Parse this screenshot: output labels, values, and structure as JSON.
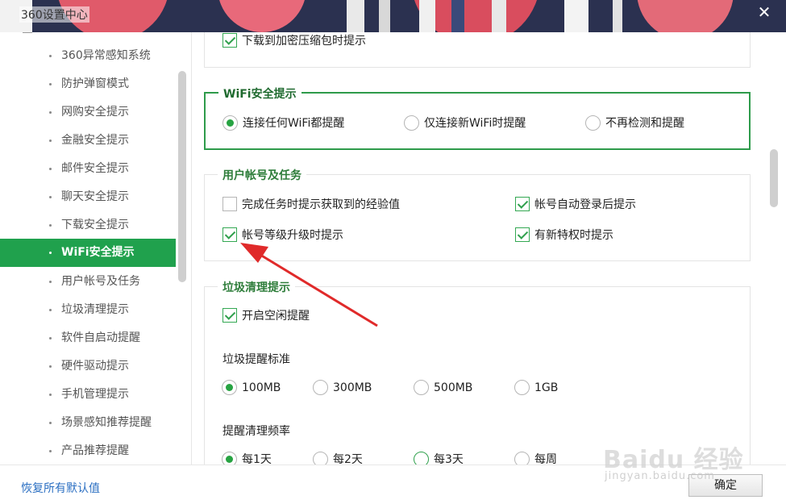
{
  "window": {
    "title": "360设置中心",
    "close_glyph": "✕"
  },
  "sidebar": {
    "items": [
      {
        "label": "360异常感知系统",
        "active": false
      },
      {
        "label": "防护弹窗模式",
        "active": false
      },
      {
        "label": "网购安全提示",
        "active": false
      },
      {
        "label": "金融安全提示",
        "active": false
      },
      {
        "label": "邮件安全提示",
        "active": false
      },
      {
        "label": "聊天安全提示",
        "active": false
      },
      {
        "label": "下载安全提示",
        "active": false
      },
      {
        "label": "WiFi安全提示",
        "active": true
      },
      {
        "label": "用户帐号及任务",
        "active": false
      },
      {
        "label": "垃圾清理提示",
        "active": false
      },
      {
        "label": "软件自启动提醒",
        "active": false
      },
      {
        "label": "硬件驱动提示",
        "active": false
      },
      {
        "label": "手机管理提示",
        "active": false
      },
      {
        "label": "场景感知推荐提醒",
        "active": false
      },
      {
        "label": "产品推荐提醒",
        "active": false
      }
    ]
  },
  "download_panel": {
    "encrypted_archive": {
      "label": "下载到加密压缩包时提示",
      "checked": true
    }
  },
  "wifi_panel": {
    "title": "WiFi安全提示",
    "options": [
      {
        "label": "连接任何WiFi都提醒",
        "selected": true
      },
      {
        "label": "仅连接新WiFi时提醒",
        "selected": false
      },
      {
        "label": "不再检测和提醒",
        "selected": false
      }
    ]
  },
  "account_panel": {
    "title": "用户帐号及任务",
    "task_exp": {
      "label": "完成任务时提示获取到的经验值",
      "checked": false
    },
    "auto_login": {
      "label": "帐号自动登录后提示",
      "checked": true
    },
    "level_up": {
      "label": "帐号等级升级时提示",
      "checked": true
    },
    "new_privilege": {
      "label": "有新特权时提示",
      "checked": true
    }
  },
  "cleanup_panel": {
    "title": "垃圾清理提示",
    "idle_reminder": {
      "label": "开启空闲提醒",
      "checked": true
    },
    "threshold_label": "垃圾提醒标准",
    "thresholds": [
      {
        "label": "100MB",
        "selected": true
      },
      {
        "label": "300MB",
        "selected": false
      },
      {
        "label": "500MB",
        "selected": false
      },
      {
        "label": "1GB",
        "selected": false
      }
    ],
    "frequency_label": "提醒清理频率",
    "frequencies": [
      {
        "label": "每1天",
        "selected": true
      },
      {
        "label": "每2天",
        "selected": false
      },
      {
        "label": "每3天",
        "selected": false
      },
      {
        "label": "每周",
        "selected": false
      }
    ]
  },
  "footer": {
    "restore_label": "恢复所有默认值",
    "ok_label": "确定"
  },
  "watermark": {
    "main": "Baidu 经验",
    "sub": "jingyan.baidu.com"
  },
  "colors": {
    "accent_green": "#20a14d",
    "annotation_arrow": "#e02a2a",
    "link_blue": "#2b6fc2"
  }
}
